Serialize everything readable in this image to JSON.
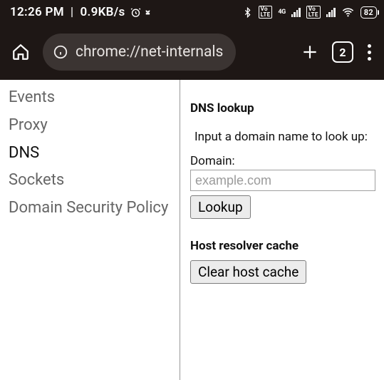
{
  "status": {
    "time": "12:26 PM",
    "net_speed": "0.9KB/s",
    "battery": "82"
  },
  "chrome": {
    "url": "chrome://net-internals",
    "tab_count": "2"
  },
  "sidebar": {
    "items": [
      {
        "label": "Events"
      },
      {
        "label": "Proxy"
      },
      {
        "label": "DNS"
      },
      {
        "label": "Sockets"
      },
      {
        "label": "Domain Security Policy"
      }
    ],
    "active_index": 2
  },
  "main": {
    "dns_lookup": {
      "title": "DNS lookup",
      "hint": "Input a domain name to look up:",
      "field_label": "Domain:",
      "placeholder": "example.com",
      "value": "",
      "button": "Lookup"
    },
    "cache": {
      "title": "Host resolver cache",
      "button": "Clear host cache"
    }
  }
}
